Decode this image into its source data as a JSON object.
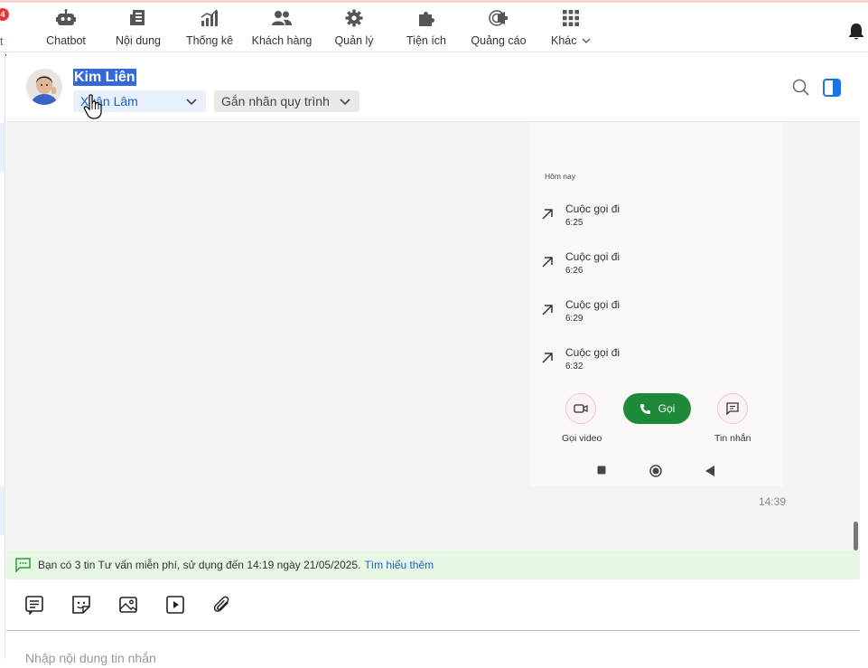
{
  "topnav": {
    "first_tab_label": "t",
    "badge_count": "4",
    "items": [
      {
        "label": "Chatbot",
        "icon": "robot-icon"
      },
      {
        "label": "Nội dung",
        "icon": "document-icon"
      },
      {
        "label": "Thống kê",
        "icon": "bar-chart-icon"
      },
      {
        "label": "Khách hàng",
        "icon": "users-icon"
      },
      {
        "label": "Quản lý",
        "icon": "gear-icon"
      },
      {
        "label": "Tiện ích",
        "icon": "puzzle-icon"
      },
      {
        "label": "Quảng cáo",
        "icon": "megaphone-icon"
      },
      {
        "label": "Khác",
        "icon": "grid-icon"
      }
    ]
  },
  "header": {
    "contact_name": "Kim Liên",
    "assignee": "Xuân Lâm",
    "label_select": "Gắn nhãn quy trình"
  },
  "phone_screenshot": {
    "section": "Hôm nay",
    "calls": [
      {
        "title": "Cuộc gọi đi",
        "time": "6:25"
      },
      {
        "title": "Cuộc gọi đi",
        "time": "6:26"
      },
      {
        "title": "Cuộc gọi đi",
        "time": "6:29"
      },
      {
        "title": "Cuộc gọi đi",
        "time": "6:32"
      }
    ],
    "video_label": "Gọi video",
    "call_label": "Gọi",
    "message_label": "Tin nhắn"
  },
  "message": {
    "time": "14:39"
  },
  "notice": {
    "text": "Bạn có 3 tin Tư vấn miễn phí, sử dụng đến 14:19 ngày 21/05/2025.",
    "link": "Tìm hiểu thêm"
  },
  "composer": {
    "placeholder": "Nhập nội dung tin nhắn"
  },
  "colors": {
    "accent": "#1a73e8",
    "call_green": "#1e8a39",
    "notice_bg": "#e6f7e3"
  }
}
